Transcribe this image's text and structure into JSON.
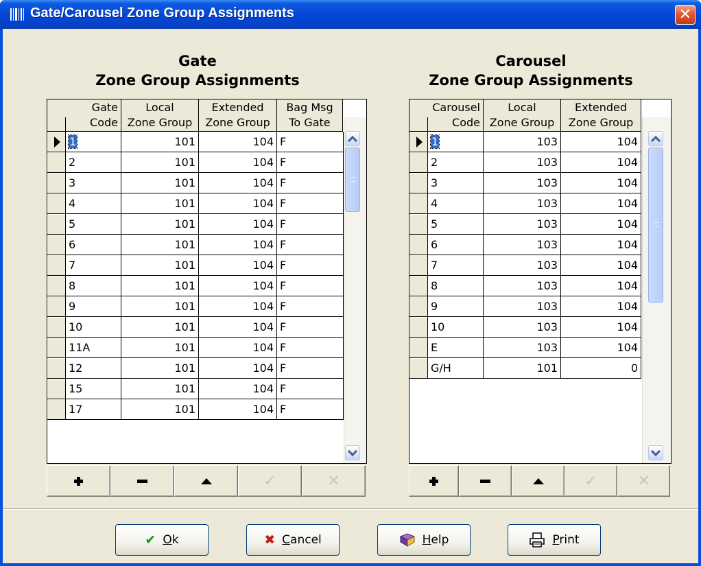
{
  "window": {
    "title": "Gate/Carousel Zone Group Assignments",
    "close_glyph": "✕"
  },
  "gate": {
    "heading_line1": "Gate",
    "heading_line2": "Zone Group Assignments",
    "columns": [
      {
        "line1": "Gate",
        "line2": "Code"
      },
      {
        "line1": "Local",
        "line2": "Zone Group"
      },
      {
        "line1": "Extended",
        "line2": "Zone Group"
      },
      {
        "line1": "Bag Msg",
        "line2": "To Gate"
      }
    ],
    "rows": [
      [
        "1",
        "101",
        "104",
        "F"
      ],
      [
        "2",
        "101",
        "104",
        "F"
      ],
      [
        "3",
        "101",
        "104",
        "F"
      ],
      [
        "4",
        "101",
        "104",
        "F"
      ],
      [
        "5",
        "101",
        "104",
        "F"
      ],
      [
        "6",
        "101",
        "104",
        "F"
      ],
      [
        "7",
        "101",
        "104",
        "F"
      ],
      [
        "8",
        "101",
        "104",
        "F"
      ],
      [
        "9",
        "101",
        "104",
        "F"
      ],
      [
        "10",
        "101",
        "104",
        "F"
      ],
      [
        "11A",
        "101",
        "104",
        "F"
      ],
      [
        "12",
        "101",
        "104",
        "F"
      ],
      [
        "15",
        "101",
        "104",
        "F"
      ],
      [
        "17",
        "101",
        "104",
        "F"
      ]
    ]
  },
  "carousel": {
    "heading_line1": "Carousel",
    "heading_line2": "Zone Group Assignments",
    "columns": [
      {
        "line1": "Carousel",
        "line2": "Code"
      },
      {
        "line1": "Local",
        "line2": "Zone Group"
      },
      {
        "line1": "Extended",
        "line2": "Zone Group"
      }
    ],
    "rows": [
      [
        "1",
        "103",
        "104"
      ],
      [
        "2",
        "103",
        "104"
      ],
      [
        "3",
        "103",
        "104"
      ],
      [
        "4",
        "103",
        "104"
      ],
      [
        "5",
        "103",
        "104"
      ],
      [
        "6",
        "103",
        "104"
      ],
      [
        "7",
        "103",
        "104"
      ],
      [
        "8",
        "103",
        "104"
      ],
      [
        "9",
        "103",
        "104"
      ],
      [
        "10",
        "103",
        "104"
      ],
      [
        "E",
        "103",
        "104"
      ],
      [
        "G/H",
        "101",
        "0"
      ]
    ]
  },
  "nav_buttons": {
    "post_glyph": "✓",
    "cancel_glyph": "✕"
  },
  "buttons": {
    "ok": {
      "label_hot": "O",
      "label_rest": "k",
      "icon": "✔"
    },
    "cancel": {
      "label_hot": "C",
      "label_rest": "ancel",
      "icon": "✖"
    },
    "help": {
      "label_hot": "H",
      "label_rest": "elp",
      "icon": "book-icon"
    },
    "print": {
      "label_hot": "P",
      "label_rest": "rint",
      "icon": "printer-icon"
    }
  }
}
